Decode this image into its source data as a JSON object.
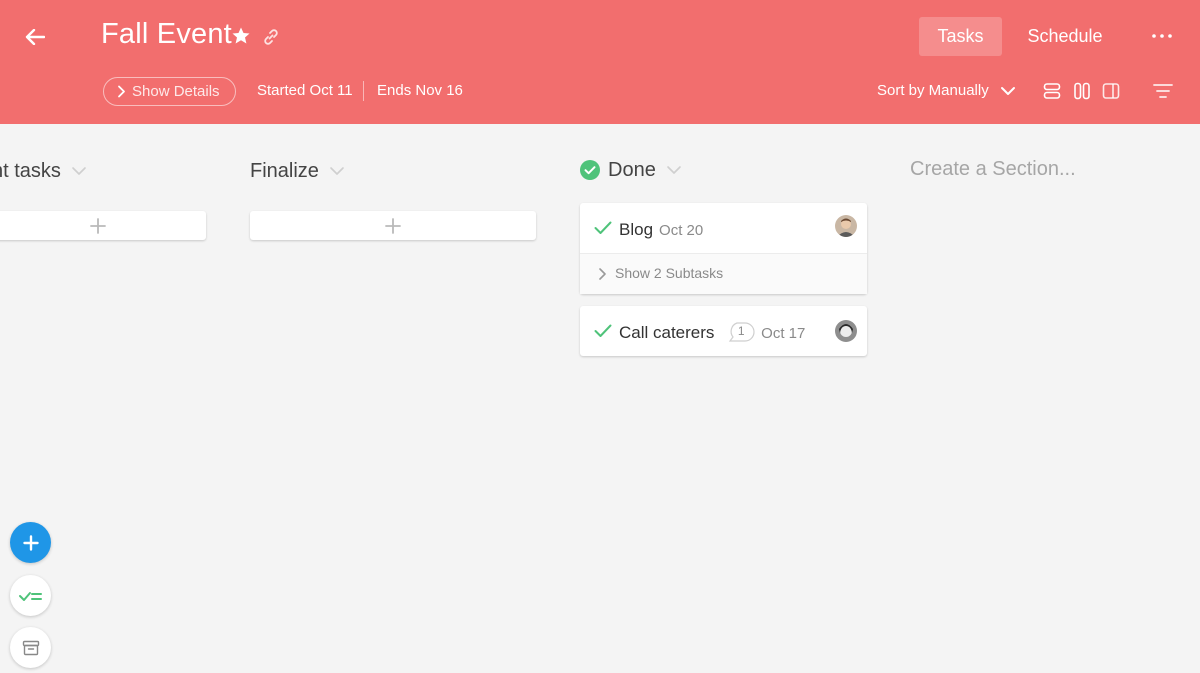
{
  "header": {
    "title": "Fall Event",
    "show_details_label": "Show Details",
    "started": "Started Oct 11",
    "ends": "Ends Nov 16",
    "tabs": [
      {
        "label": "Tasks",
        "active": true
      },
      {
        "label": "Schedule",
        "active": false
      }
    ],
    "sort_label": "Sort by Manually"
  },
  "sections": [
    {
      "title": "nt tasks"
    },
    {
      "title": "Finalize"
    },
    {
      "title": "Done"
    }
  ],
  "create_section_placeholder": "Create a Section...",
  "tasks": [
    {
      "title": "Blog",
      "date": "Oct 20",
      "subtasks_label": "Show 2 Subtasks"
    },
    {
      "title": "Call caterers",
      "comments": "1",
      "date": "Oct 17"
    }
  ],
  "colors": {
    "header_bg": "#f26e6e",
    "accent_blue": "#1f96e7",
    "done_green": "#4fc37a"
  }
}
